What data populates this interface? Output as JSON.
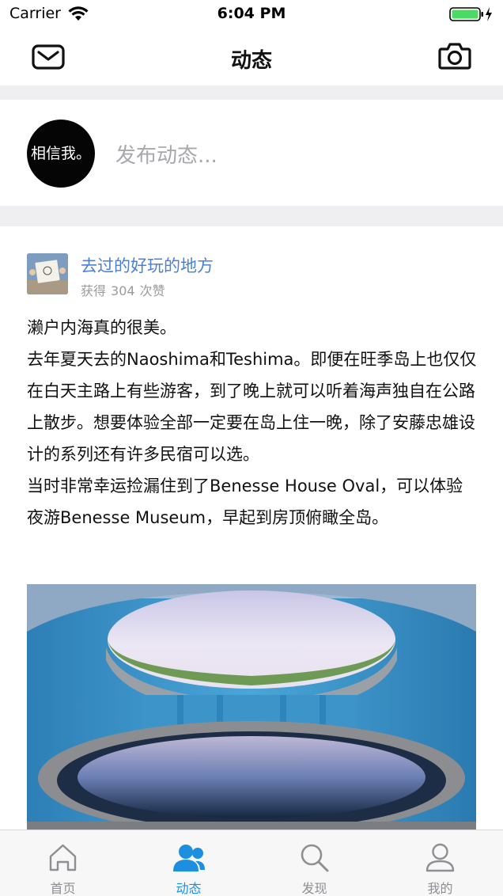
{
  "status_bar": {
    "carrier": "Carrier",
    "time": "6:04 PM"
  },
  "nav": {
    "title": "动态",
    "left_icon": "mail-icon",
    "right_icon": "camera-icon"
  },
  "composer": {
    "avatar_text": "相信我。",
    "placeholder": "发布动态..."
  },
  "post": {
    "title": "去过的好玩的地方",
    "likes_prefix": "获得",
    "likes_count": "304",
    "likes_suffix": "次赞",
    "body": [
      "濑户内海真的很美。",
      "去年夏天去的Naoshima和Teshima。即便在旺季岛上也仅仅在白天主路上有些游客，到了晚上就可以听着海声独自在公路上散步。想要体验全部一定要在岛上住一晚，除了安藤忠雄设计的系列还有许多民宿可以选。",
      "当时非常幸运捡漏住到了Benesse House Oval，可以体验夜游Benesse Museum，早起到房顶俯瞰全岛。"
    ]
  },
  "tabs": [
    {
      "label": "首页",
      "icon": "home-icon",
      "active": false
    },
    {
      "label": "动态",
      "icon": "people-icon",
      "active": true
    },
    {
      "label": "发现",
      "icon": "search-icon",
      "active": false
    },
    {
      "label": "我的",
      "icon": "person-icon",
      "active": false
    }
  ],
  "colors": {
    "accent": "#1d8fe0",
    "link": "#4a80d8",
    "separator": "#efeff1",
    "inactive": "#8e8e93"
  }
}
